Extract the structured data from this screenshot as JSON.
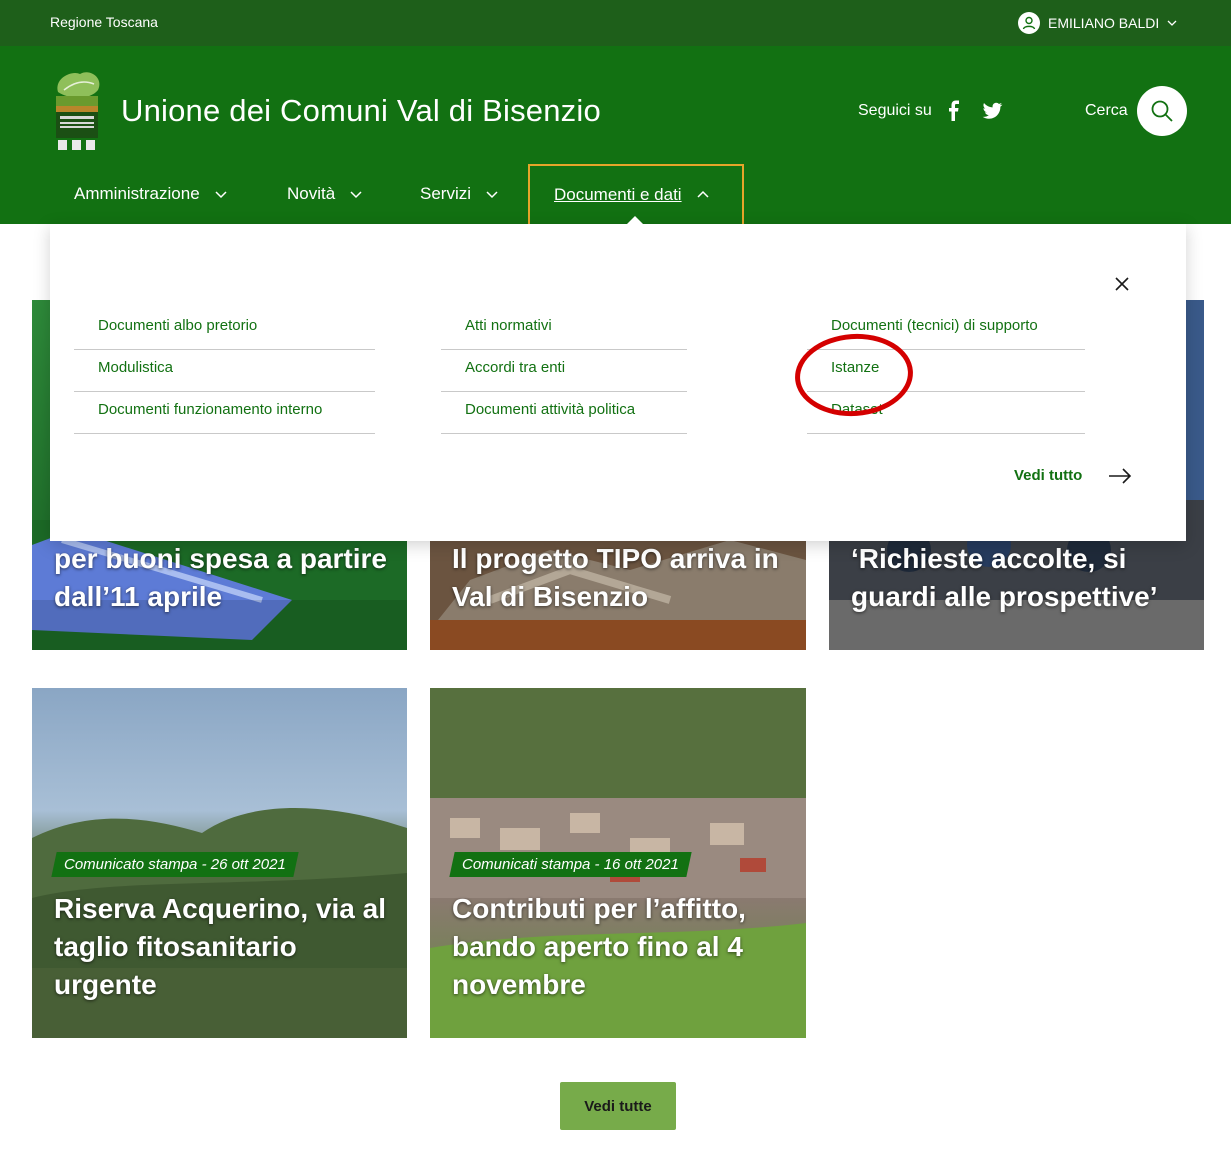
{
  "topbar": {
    "region": "Regione Toscana",
    "user_name": "EMILIANO BALDI"
  },
  "header": {
    "site_title": "Unione dei Comuni Val di Bisenzio",
    "follow_label": "Seguici su",
    "search_label": "Cerca"
  },
  "nav": {
    "items": [
      {
        "label": "Amministrazione"
      },
      {
        "label": "Novità"
      },
      {
        "label": "Servizi"
      },
      {
        "label": "Documenti e dati"
      }
    ]
  },
  "mega_menu": {
    "columns": [
      [
        "Documenti albo pretorio",
        "Modulistica",
        "Documenti funzionamento interno"
      ],
      [
        "Atti normativi",
        "Accordi tra enti",
        "Documenti attività politica"
      ],
      [
        "Documenti (tecnici) di supporto",
        "Istanze",
        "Dataset"
      ]
    ],
    "see_all": "Vedi tutto"
  },
  "cards": [
    {
      "title": "per buoni spesa a partire dall’11 aprile"
    },
    {
      "title": "Il progetto TIPO arriva in Val di Bisenzio"
    },
    {
      "title": "‘Richieste accolte, si guardi alle prospettive’"
    },
    {
      "tag": "Comunicato stampa - 26 ott 2021",
      "title": "Riserva Acquerino, via al taglio fitosanitario urgente"
    },
    {
      "tag": "Comunicati stampa - 16 ott 2021",
      "title": "Contributi per l’affitto, bando aperto fino al 4 novembre"
    }
  ],
  "footer": {
    "see_all_button": "Vedi tutte"
  },
  "colors": {
    "header_green": "#127112",
    "topbar_green": "#1e5f1a",
    "active_border": "#e5a52a",
    "button_green": "#77ab4a",
    "annotation_red": "#d40000"
  }
}
